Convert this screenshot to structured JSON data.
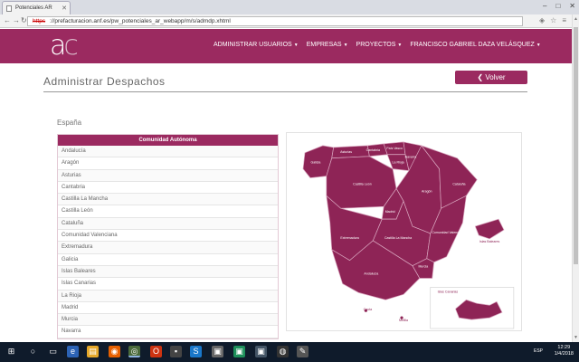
{
  "browser": {
    "tab_title": "Potenciales AR",
    "url_scheme": "https",
    "url_rest": "://prefacturacion.anf.es/pw_potenciales_ar_webapp/m/s/admdp.xhtml"
  },
  "app": {
    "logo_a": "a",
    "logo_c": "c",
    "nav": [
      {
        "label": "ADMINISTRAR USUARIOS"
      },
      {
        "label": "EMPRESAS"
      },
      {
        "label": "PROYECTOS"
      },
      {
        "label": "FRANCISCO GABRIEL DAZA VELÁSQUEZ"
      }
    ]
  },
  "page": {
    "title": "Administrar Despachos",
    "back_button": "Volver",
    "country": "España"
  },
  "table": {
    "header": "Comunidad Autónoma",
    "rows": [
      "Andalucía",
      "Aragón",
      "Asturias",
      "Cantabria",
      "Castilla La Mancha",
      "Castilla León",
      "Cataluña",
      "Comunidad Valenciana",
      "Extremadura",
      "Galicia",
      "Islas Baleares",
      "Islas Canarias",
      "La Rioja",
      "Madrid",
      "Murcia",
      "Navarra"
    ]
  },
  "map": {
    "fill": "#8e2456",
    "stroke": "#d9a6bf",
    "labels": {
      "galicia": "Galicia",
      "asturias": "Asturias",
      "cantabria": "Cantabria",
      "pais_vasco": "País Vasco",
      "navarra": "Navarra",
      "la_rioja": "La Rioja",
      "castilla_leon": "Castilla León",
      "aragon": "Aragón",
      "cataluna": "Cataluña",
      "madrid": "Madrid",
      "extremadura": "Extremadura",
      "castilla_mancha": "Castilla La Mancha",
      "valenciana": "Comunidad Valenciana",
      "baleares": "Islas Baleares",
      "murcia": "Murcia",
      "andalucia": "Andalucía",
      "ceuta": "Ceuta",
      "melilla": "Melilla",
      "canarias": "Islas Canarias"
    }
  },
  "taskbar": {
    "time": "12:29",
    "date": "1/4/2018",
    "lang": "ESP"
  }
}
